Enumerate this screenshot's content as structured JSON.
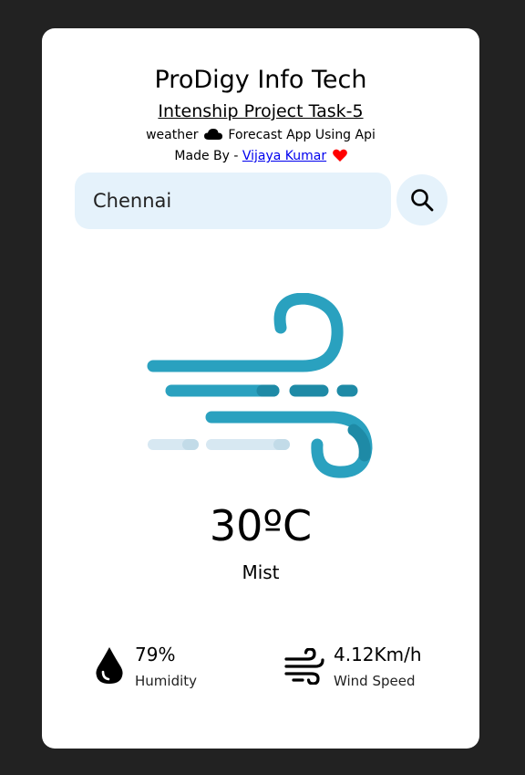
{
  "header": {
    "title": "ProDigy Info Tech",
    "subtitle": "Intenship Project Task-5",
    "desc_pre": "weather",
    "desc_post": "Forecast App Using Api",
    "madeby_prefix": "Made By -",
    "author": "Vijaya Kumar"
  },
  "search": {
    "value": "Chennai",
    "button_icon": "search-icon"
  },
  "weather": {
    "icon": "wind-weather-icon",
    "temperature": "30ºC",
    "condition": "Mist"
  },
  "stats": {
    "humidity_value": "79%",
    "humidity_label": "Humidity",
    "wind_value": "4.12Km/h",
    "wind_label": "Wind Speed"
  },
  "colors": {
    "background": "#222222",
    "card": "#ffffff",
    "input_bg": "#e5f2fb",
    "wind_primary": "#2aa1bf",
    "wind_dark": "#1e8aa6",
    "wind_light": "#d7e8f2",
    "heart": "#ff0000",
    "link": "#0000ee"
  }
}
